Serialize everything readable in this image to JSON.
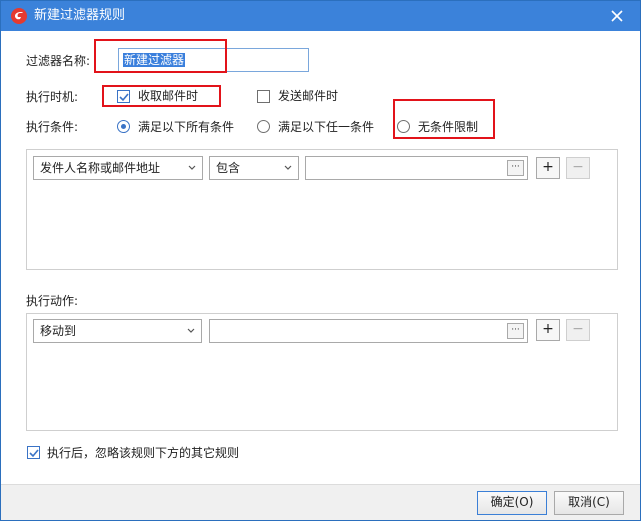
{
  "window": {
    "title": "新建过滤器规则",
    "app_icon": "foxmail-logo-icon",
    "close_icon": "close-icon"
  },
  "form": {
    "name_label": "过滤器名称:",
    "name_value": "新建过滤器",
    "timing_label": "执行时机:",
    "timing_options": [
      {
        "label": "收取邮件时",
        "checked": true
      },
      {
        "label": "发送邮件时",
        "checked": false
      }
    ],
    "condition_label": "执行条件:",
    "condition_options": [
      {
        "label": "满足以下所有条件",
        "selected": true
      },
      {
        "label": "满足以下任一条件",
        "selected": false
      },
      {
        "label": "无条件限制",
        "selected": false
      }
    ]
  },
  "conditions": {
    "field_select": "发件人名称或邮件地址",
    "operator_select": "包含",
    "value": "",
    "ellipsis": "···",
    "add": "+",
    "remove": "−"
  },
  "actions": {
    "label": "执行动作:",
    "action_select": "移动到",
    "value": "",
    "ellipsis": "···",
    "add": "+",
    "remove": "−"
  },
  "ignore_rule": {
    "label": "执行后，忽略该规则下方的其它规则",
    "checked": true
  },
  "buttons": {
    "ok": "确定(O)",
    "cancel": "取消(C)"
  },
  "colors": {
    "titlebar": "#3b82da",
    "highlight": "#e2131a",
    "accent": "#3a73c6"
  }
}
